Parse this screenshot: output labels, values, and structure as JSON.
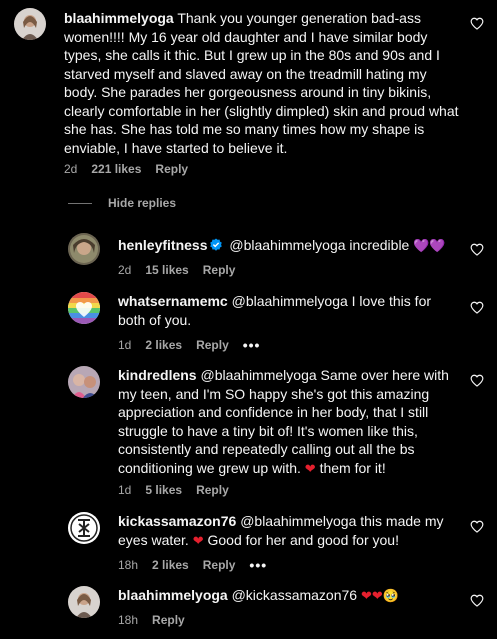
{
  "comments": [
    {
      "username": "blaahimmelyoga",
      "text": "Thank you younger generation bad-ass women!!!! My 16 year old daughter and I have similar body types, she calls it thic. But I grew up in the 80s and 90s and I starved myself and slaved away on the treadmill hating my body. She parades her gorgeousness around in tiny bikinis, clearly comfortable in her (slightly dimpled) skin and proud what she has. She has told me so many times how my shape is enviable, I have started to believe it.",
      "time": "2d",
      "likes": "221 likes",
      "reply": "Reply"
    }
  ],
  "hide_replies": "Hide replies",
  "replies": [
    {
      "username": "henleyfitness",
      "mention": "@blaahimmelyoga",
      "text": " incredible ",
      "emoji": "💜💜",
      "time": "2d",
      "likes": "15 likes",
      "reply": "Reply"
    },
    {
      "username": "whatsernamemc",
      "mention": "@blaahimmelyoga",
      "text": " I love this for both of you.",
      "time": "1d",
      "likes": "2 likes",
      "reply": "Reply",
      "more": "•••"
    },
    {
      "username": "kindredlens",
      "mention": "@blaahimmelyoga",
      "text": " Same over here with my teen, and I'm SO happy she's got this amazing appreciation and confidence in her body, that I still struggle to have a tiny bit of! It's women like this, consistently and repeatedly calling out all the bs conditioning we grew up with. ",
      "emoji": "❤",
      "text_after": " them for it!",
      "time": "1d",
      "likes": "5 likes",
      "reply": "Reply"
    },
    {
      "username": "kickassamazon76",
      "mention": "@blaahimmelyoga",
      "text": " this made my eyes water. ",
      "emoji": "❤",
      "text_after": " Good for her and good for you!",
      "time": "18h",
      "likes": "2 likes",
      "reply": "Reply",
      "more": "•••"
    },
    {
      "username": "blaahimmelyoga",
      "mention": "@kickassamazon76",
      "text": " ",
      "emoji": "❤❤",
      "emoji2": "🥹",
      "time": "18h",
      "reply": "Reply"
    }
  ],
  "colors": {
    "background": "#000000",
    "text": "#f5f5f5",
    "secondary": "#a8a8a8",
    "verified": "#0095f6",
    "heart_red": "#e5202e",
    "heart_purple": "#a03ad8"
  },
  "icons": {
    "like": "heart-outline-icon",
    "verified": "verified-badge-icon",
    "more": "more-options-icon"
  }
}
